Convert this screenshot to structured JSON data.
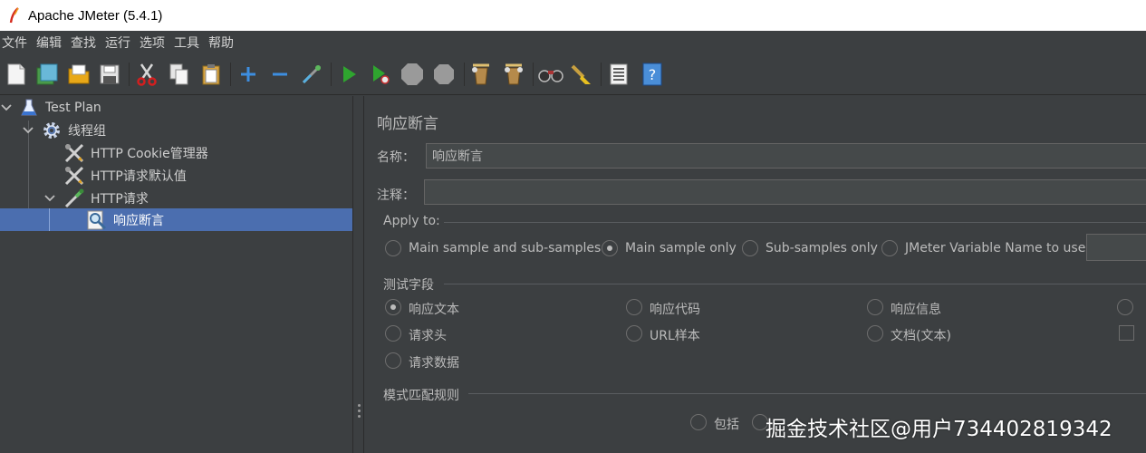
{
  "window": {
    "title": "Apache JMeter (5.4.1)"
  },
  "menu": [
    "文件",
    "编辑",
    "查找",
    "运行",
    "选项",
    "工具",
    "帮助"
  ],
  "toolbar": {
    "icons": [
      "new-icon",
      "templates-icon",
      "open-icon",
      "save-icon",
      "cut-icon",
      "copy-icon",
      "paste-icon",
      "expand-icon",
      "collapse-icon",
      "toggle-icon",
      "start-icon",
      "start-no-pauses-icon",
      "stop-icon",
      "shutdown-icon",
      "clear-icon",
      "clear-all-icon",
      "search-icon",
      "reset-search-icon",
      "function-helper-icon",
      "help-icon"
    ]
  },
  "tree": {
    "items": [
      {
        "label": "Test Plan",
        "icon": "flask-icon"
      },
      {
        "label": "线程组",
        "icon": "gear-icon"
      },
      {
        "label": "HTTP Cookie管理器",
        "icon": "config-tools-icon"
      },
      {
        "label": "HTTP请求默认值",
        "icon": "config-tools-icon"
      },
      {
        "label": "HTTP请求",
        "icon": "sampler-pipette-icon"
      },
      {
        "label": "响应断言",
        "icon": "assertion-magnifier-icon"
      }
    ]
  },
  "panel": {
    "title": "响应断言",
    "name_label": "名称：",
    "name_value": "响应断言",
    "comment_label": "注释：",
    "comment_value": "",
    "apply_to": {
      "title": "Apply to:",
      "options": [
        "Main sample and sub-samples",
        "Main sample only",
        "Sub-samples only",
        "JMeter Variable Name to use"
      ],
      "selected": "Main sample only"
    },
    "test_field": {
      "title": "测试字段",
      "options": [
        "响应文本",
        "响应代码",
        "响应信息",
        "请求头",
        "URL样本",
        "文档(文本)",
        "请求数据"
      ],
      "selected": "响应文本"
    },
    "pattern_rules": {
      "title": "模式匹配规则",
      "options": [
        "包括"
      ]
    }
  },
  "watermark": "掘金技术社区@用户734402819342",
  "colors": {
    "background": "#3c3f41",
    "selection": "#4b6eaf",
    "text": "#bbbbbb"
  }
}
